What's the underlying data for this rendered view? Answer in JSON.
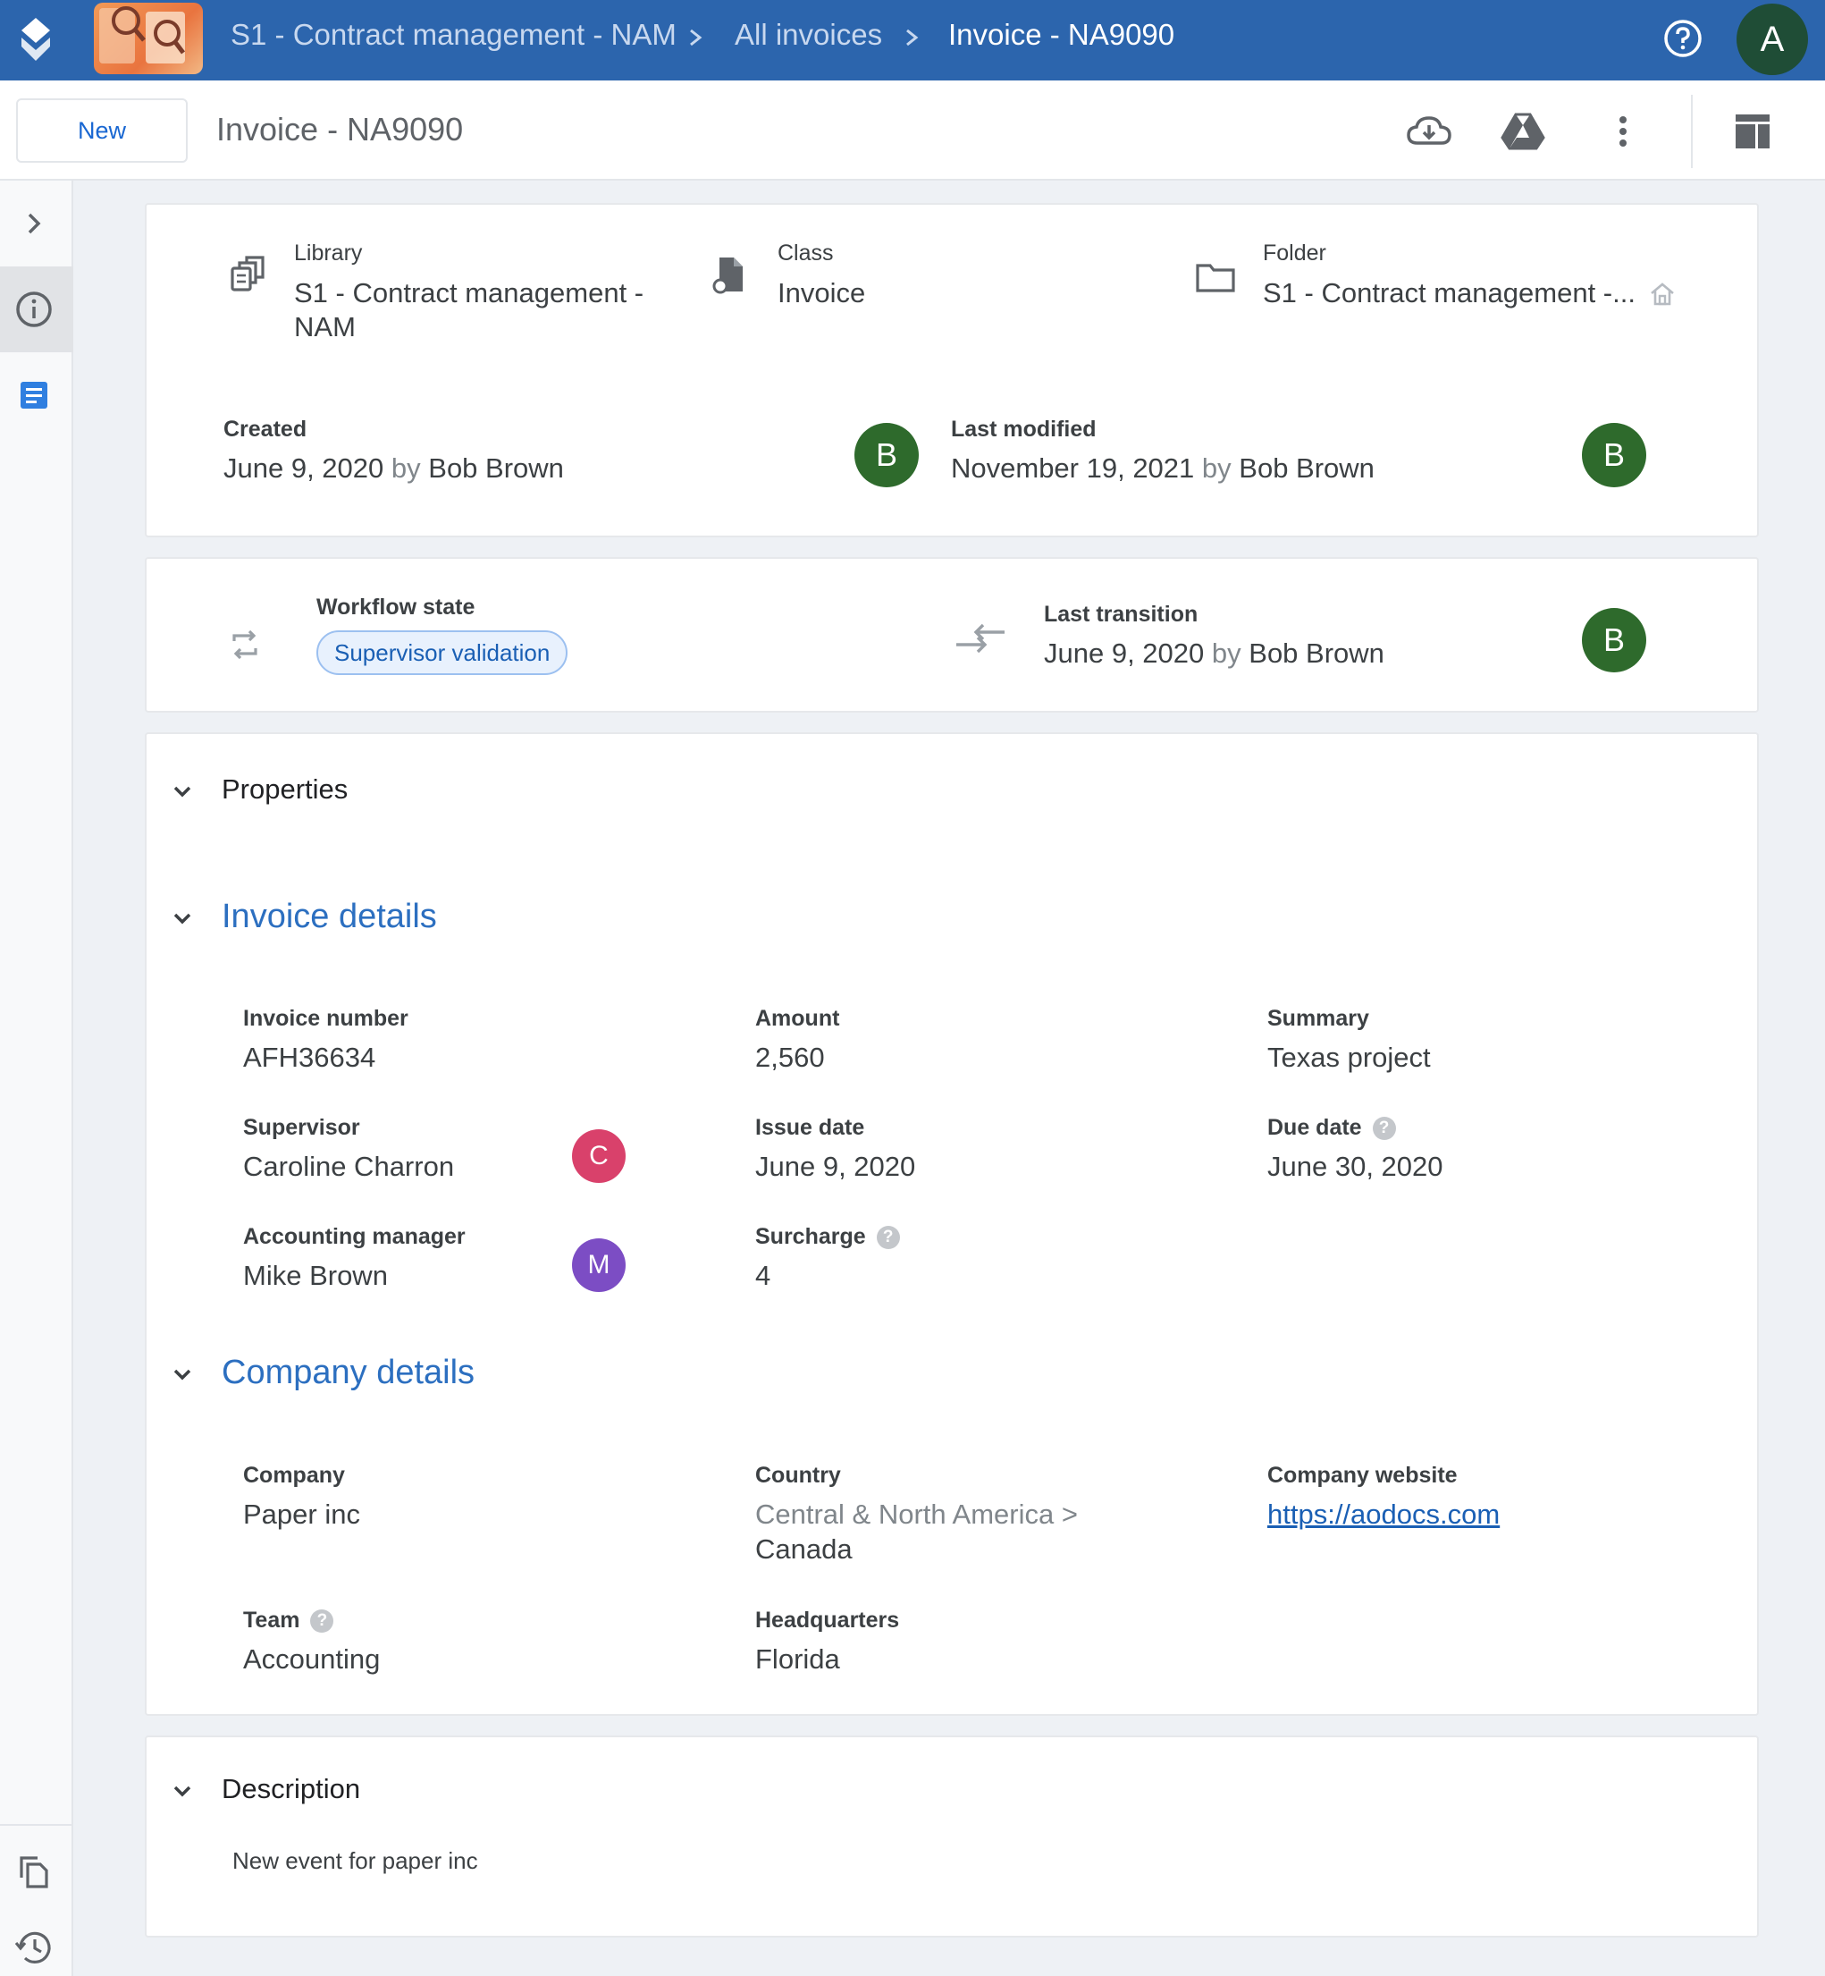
{
  "topbar": {
    "breadcrumb": [
      "S1 - Contract management - NAM",
      "All invoices",
      "Invoice - NA9090"
    ],
    "account_initial": "A"
  },
  "toolbar": {
    "new_label": "New",
    "title": "Invoice - NA9090"
  },
  "info": {
    "library_label": "Library",
    "library_value_line1": "S1 - Contract management -",
    "library_value_line2": "NAM",
    "class_label": "Class",
    "class_value": "Invoice",
    "folder_label": "Folder",
    "folder_value": "S1 - Contract management -...",
    "created_label": "Created",
    "created_date": "June 9, 2020",
    "created_by_word": "by",
    "created_by": "Bob Brown",
    "created_avatar": "B",
    "modified_label": "Last modified",
    "modified_date": "November 19, 2021",
    "modified_by_word": "by",
    "modified_by": "Bob Brown",
    "modified_avatar": "B"
  },
  "workflow": {
    "state_label": "Workflow state",
    "state_value": "Supervisor validation",
    "transition_label": "Last transition",
    "transition_date": "June 9, 2020",
    "transition_by_word": "by",
    "transition_by": "Bob Brown",
    "transition_avatar": "B"
  },
  "properties": {
    "title": "Properties",
    "invoice_details": {
      "title": "Invoice details",
      "invoice_number_label": "Invoice number",
      "invoice_number": "AFH36634",
      "amount_label": "Amount",
      "amount": "2,560",
      "summary_label": "Summary",
      "summary": "Texas project",
      "supervisor_label": "Supervisor",
      "supervisor": "Caroline Charron",
      "supervisor_avatar": "C",
      "issue_date_label": "Issue date",
      "issue_date": "June 9, 2020",
      "due_date_label": "Due date",
      "due_date": "June 30, 2020",
      "accounting_manager_label": "Accounting manager",
      "accounting_manager": "Mike Brown",
      "accounting_manager_avatar": "M",
      "surcharge_label": "Surcharge",
      "surcharge": "4"
    },
    "company_details": {
      "title": "Company details",
      "company_label": "Company",
      "company": "Paper inc",
      "country_label": "Country",
      "country_path": "Central & North America >",
      "country": "Canada",
      "website_label": "Company website",
      "website": "https://aodocs.com",
      "team_label": "Team",
      "team": "Accounting",
      "hq_label": "Headquarters",
      "hq": "Florida"
    }
  },
  "description": {
    "title": "Description",
    "text": "New event for paper inc"
  },
  "help_glyph": "?",
  "colors": {
    "topbar": "#2c65ad",
    "accent": "#1a5fb4",
    "avatar_green": "#2e6a2c",
    "avatar_pink": "#d9416b",
    "avatar_purple": "#7c4dc4"
  }
}
